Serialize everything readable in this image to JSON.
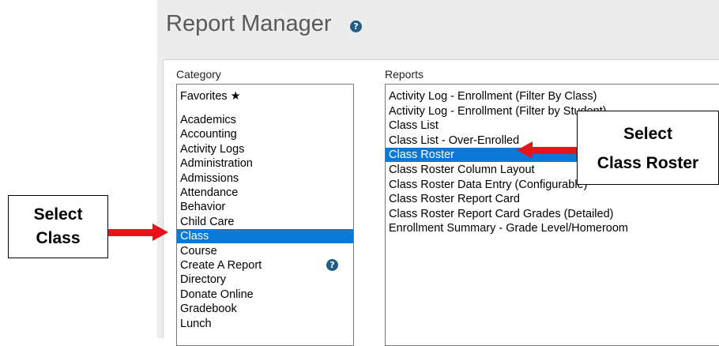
{
  "header": {
    "title": "Report Manager",
    "help_icon": "question-circle"
  },
  "category": {
    "label": "Category",
    "favorites": "Favorites ★",
    "items": [
      "Academics",
      "Accounting",
      "Activity Logs",
      "Administration",
      "Admissions",
      "Attendance",
      "Behavior",
      "Child Care",
      "Class",
      "Course",
      "Create A Report",
      "Directory",
      "Donate Online",
      "Gradebook",
      "Lunch"
    ],
    "selected": "Class"
  },
  "reports": {
    "label": "Reports",
    "items": [
      "Activity Log - Enrollment (Filter By Class)",
      "Activity Log - Enrollment (Filter by Student)",
      "Class List",
      "Class List - Over-Enrolled",
      "Class Roster",
      "Class Roster Column Layout",
      "Class Roster Data Entry (Configurable)",
      "Class Roster Report Card",
      "Class Roster Report Card Grades (Detailed)",
      "Enrollment Summary - Grade Level/Homeroom"
    ],
    "selected": "Class Roster"
  },
  "callouts": {
    "class": {
      "line1": "Select",
      "line2": "Class"
    },
    "roster": {
      "line1": "Select",
      "line2": "Class Roster"
    }
  },
  "colors": {
    "selection": "#0a78d7",
    "arrow": "#e8121b",
    "help": "#1f5e86"
  }
}
